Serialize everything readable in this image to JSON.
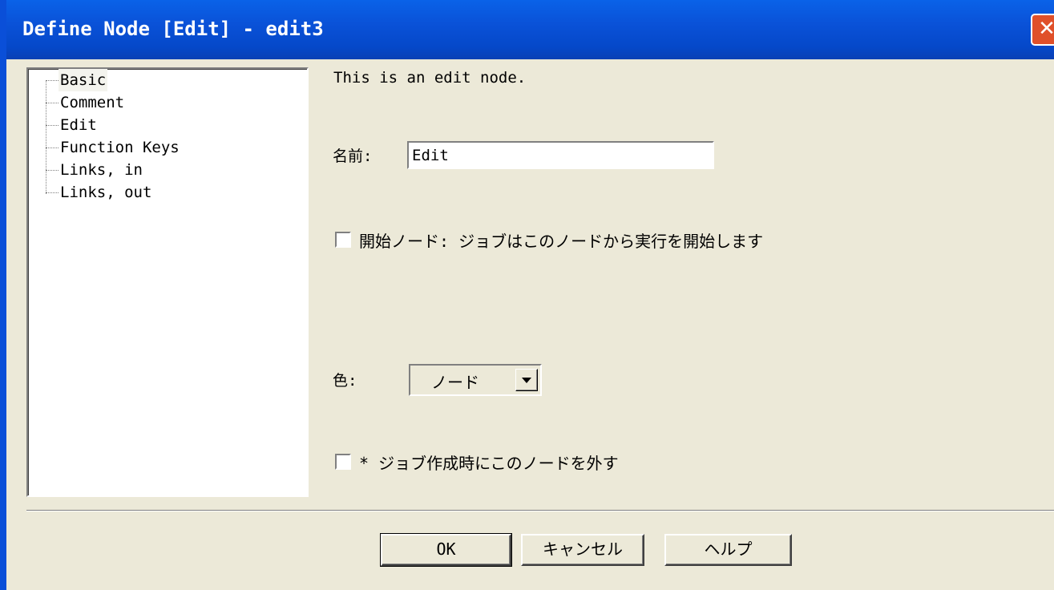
{
  "window": {
    "title": "Define Node [Edit] - edit3",
    "close_glyph": "✕"
  },
  "tree": {
    "items": [
      {
        "label": "Basic",
        "selected": true
      },
      {
        "label": "Comment"
      },
      {
        "label": "Edit"
      },
      {
        "label": "Function Keys"
      },
      {
        "label": "Links, in"
      },
      {
        "label": "Links, out"
      }
    ]
  },
  "basic": {
    "description": "This is an edit node.",
    "name_label": "名前:",
    "name_value": "Edit",
    "start_node_checked": false,
    "start_node_label": "開始ノード: ジョブはこのノードから実行を開始します",
    "color_label": "色:",
    "color_value": "ノード",
    "exclude_checked": false,
    "exclude_label": "* ジョブ作成時にこのノードを外す"
  },
  "buttons": {
    "ok": "OK",
    "cancel": "キャンセル",
    "help": "ヘルプ"
  },
  "colors": {
    "titlebar": "#0a52d8",
    "face": "#ece9d8",
    "close": "#e0502a"
  },
  "icons": [
    "close-icon",
    "chevron-down-icon"
  ]
}
